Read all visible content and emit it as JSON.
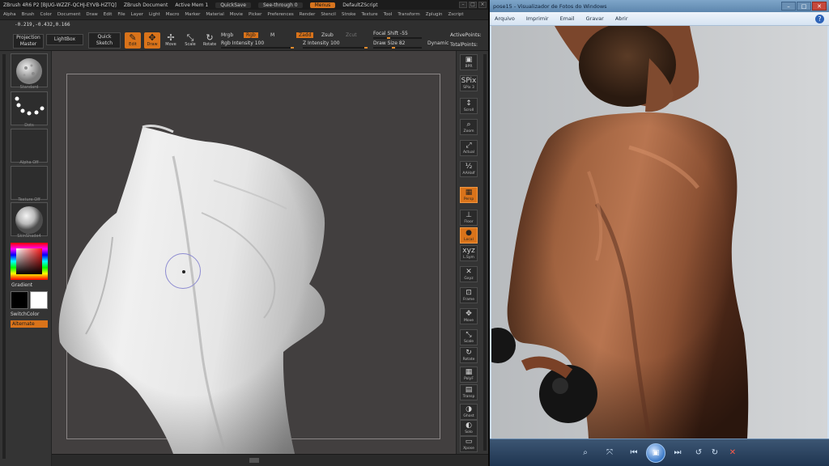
{
  "zbrush": {
    "title_items": [
      "ZBrush 4R6 P2 [BJUG-WZZF-QCHJ-EYVB-HZTQ]",
      "ZBrush Document",
      "Active Mem 1",
      "QuickSave",
      "See-through 0",
      "Menus",
      "DefaultZScript"
    ],
    "menu_items": [
      "Alpha",
      "Brush",
      "Color",
      "Document",
      "Draw",
      "Edit",
      "File",
      "Layer",
      "Light",
      "Macro",
      "Marker",
      "Material",
      "Movie",
      "Picker",
      "Preferences",
      "Render",
      "Stencil",
      "Stroke",
      "Texture",
      "Tool",
      "Transform",
      "Zplugin",
      "Zscript"
    ],
    "coords": "-0.219,-0.432,0.166",
    "toolbar": {
      "projection_master": "Projection Master",
      "lightbox": "LightBox",
      "quick_sketch": "Quick Sketch",
      "edit": "Edit",
      "draw": "Draw",
      "move": "Move",
      "scale": "Scale",
      "rotate": "Rotate",
      "mrgb": "Mrgb",
      "rgb": "Rgb",
      "m": "M",
      "rgb_intensity_label": "Rgb Intensity",
      "rgb_intensity": "100",
      "zadd": "Zadd",
      "zsub": "Zsub",
      "zcut": "Zcut",
      "z_intensity_label": "Z Intensity",
      "z_intensity": "100",
      "focal_shift_label": "Focal Shift",
      "focal_shift": "-55",
      "draw_size_label": "Draw Size",
      "draw_size": "82",
      "dynamic": "Dynamic",
      "active_points_label": "ActivePoints:",
      "total_points_label": "TotalPoints:"
    },
    "left_shelf": {
      "brush_label": "Standard",
      "stroke_label": "Dots",
      "alpha_label": "Alpha Off",
      "texture_label": "Texture Off",
      "material_label": "SkinShade4",
      "gradient": "Gradient",
      "switch_color": "SwitchColor",
      "alternate": "Alternate"
    },
    "right_shelf": [
      {
        "icon": "▣",
        "label": "BPR"
      },
      {
        "icon": "SPix",
        "label": "SPix 3"
      },
      {
        "icon": "↕",
        "label": "Scroll"
      },
      {
        "icon": "⌕",
        "label": "Zoom"
      },
      {
        "icon": "⤢",
        "label": "Actual"
      },
      {
        "icon": "½",
        "label": "AAHalf"
      },
      {
        "icon": "▦",
        "label": "Persp"
      },
      {
        "icon": "⊥",
        "label": "Floor"
      },
      {
        "icon": "●",
        "label": "Local"
      },
      {
        "icon": "xyz",
        "label": "L.Sym"
      },
      {
        "icon": "✕",
        "label": "Gxyz"
      },
      {
        "icon": "⊡",
        "label": "Frame"
      },
      {
        "icon": "✥",
        "label": "Move"
      },
      {
        "icon": "⤡",
        "label": "Scale"
      },
      {
        "icon": "↻",
        "label": "Rotate"
      },
      {
        "icon": "▦",
        "label": "PolyF"
      },
      {
        "icon": "▤",
        "label": "Transp"
      },
      {
        "icon": "◑",
        "label": "Ghost"
      },
      {
        "icon": "◐",
        "label": "Solo"
      },
      {
        "icon": "▭",
        "label": "Xpose"
      }
    ],
    "colors": {
      "accent": "#d9731a",
      "canvas": "#423f3f",
      "panel": "#343434"
    }
  },
  "viewer": {
    "title": "pose15 - Visualizador de Fotos do Windows",
    "menu": [
      "Arquivo",
      "Imprimir",
      "Email",
      "Gravar",
      "Abrir"
    ],
    "toolbar": [
      {
        "name": "zoom-icon",
        "glyph": "⌕"
      },
      {
        "name": "fit-icon",
        "glyph": "⤧"
      },
      {
        "name": "previous-icon",
        "glyph": "⏮"
      },
      {
        "name": "slideshow-icon",
        "glyph": "▣"
      },
      {
        "name": "next-icon",
        "glyph": "⏭"
      },
      {
        "name": "rotate-left-icon",
        "glyph": "↺"
      },
      {
        "name": "rotate-right-icon",
        "glyph": "↻"
      },
      {
        "name": "delete-icon",
        "glyph": "✕"
      }
    ]
  }
}
